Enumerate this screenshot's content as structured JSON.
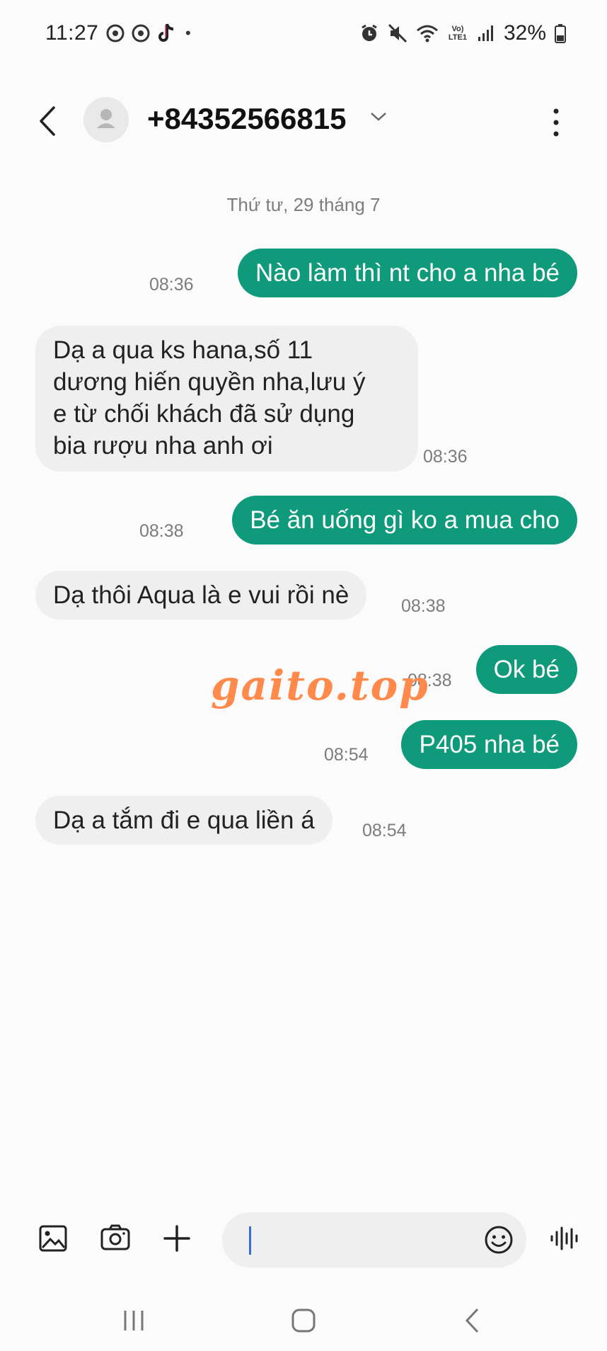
{
  "status_bar": {
    "time": "11:27",
    "dot": "•",
    "battery": "32%",
    "network_label": "Vo) LTE1"
  },
  "header": {
    "contact": "+84352566815"
  },
  "conversation": {
    "date": "Thứ tư, 29 tháng 7",
    "messages": [
      {
        "direction": "outgoing",
        "text": "Nào làm thì nt cho a nha bé",
        "time": "08:36"
      },
      {
        "direction": "incoming",
        "lines": [
          "Dạ a qua ks hana,số 11",
          "dương hiến quyền nha,lưu ý",
          "e từ chối khách đã sử dụng",
          "bia rượu nha anh ơi"
        ],
        "time": "08:36"
      },
      {
        "direction": "outgoing",
        "text": "Bé ăn uống gì ko a mua cho",
        "time": "08:38"
      },
      {
        "direction": "incoming",
        "text": "Dạ thôi Aqua là e vui rồi nè",
        "time": "08:38"
      },
      {
        "direction": "outgoing",
        "text": "Ok bé",
        "time": "08:38"
      },
      {
        "direction": "outgoing",
        "text": "P405 nha bé",
        "time": "08:54"
      },
      {
        "direction": "incoming",
        "text": "Dạ a tắm đi e qua liền á",
        "time": "08:54"
      }
    ]
  },
  "watermark": "gaito.top",
  "composer": {
    "value": ""
  },
  "icons": {
    "status": [
      "chrome-icon",
      "chrome-icon",
      "tiktok-icon",
      "alarm-icon",
      "mute-icon",
      "wifi-icon",
      "signal-icon",
      "battery-icon"
    ],
    "composer": [
      "gallery-icon",
      "camera-icon",
      "plus-icon",
      "emoji-icon",
      "voice-icon"
    ],
    "nav": [
      "recents-icon",
      "home-icon",
      "back-icon"
    ]
  },
  "colors": {
    "outgoing_bubble": "#0f9a7c",
    "incoming_bubble": "#efefef",
    "watermark": "#ff8a4c",
    "caret": "#3a6bd7"
  }
}
